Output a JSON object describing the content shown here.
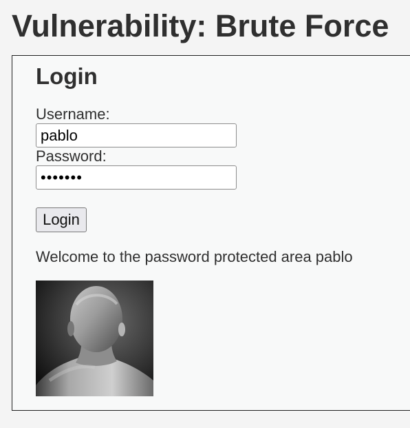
{
  "page": {
    "title": "Vulnerability: Brute Force"
  },
  "login_form": {
    "heading": "Login",
    "username_label": "Username:",
    "username_value": "pablo",
    "password_label": "Password:",
    "password_value": "letmein",
    "submit_label": "Login"
  },
  "result": {
    "welcome_message": "Welcome to the password protected area pablo",
    "image_description": "user-avatar-photo"
  }
}
